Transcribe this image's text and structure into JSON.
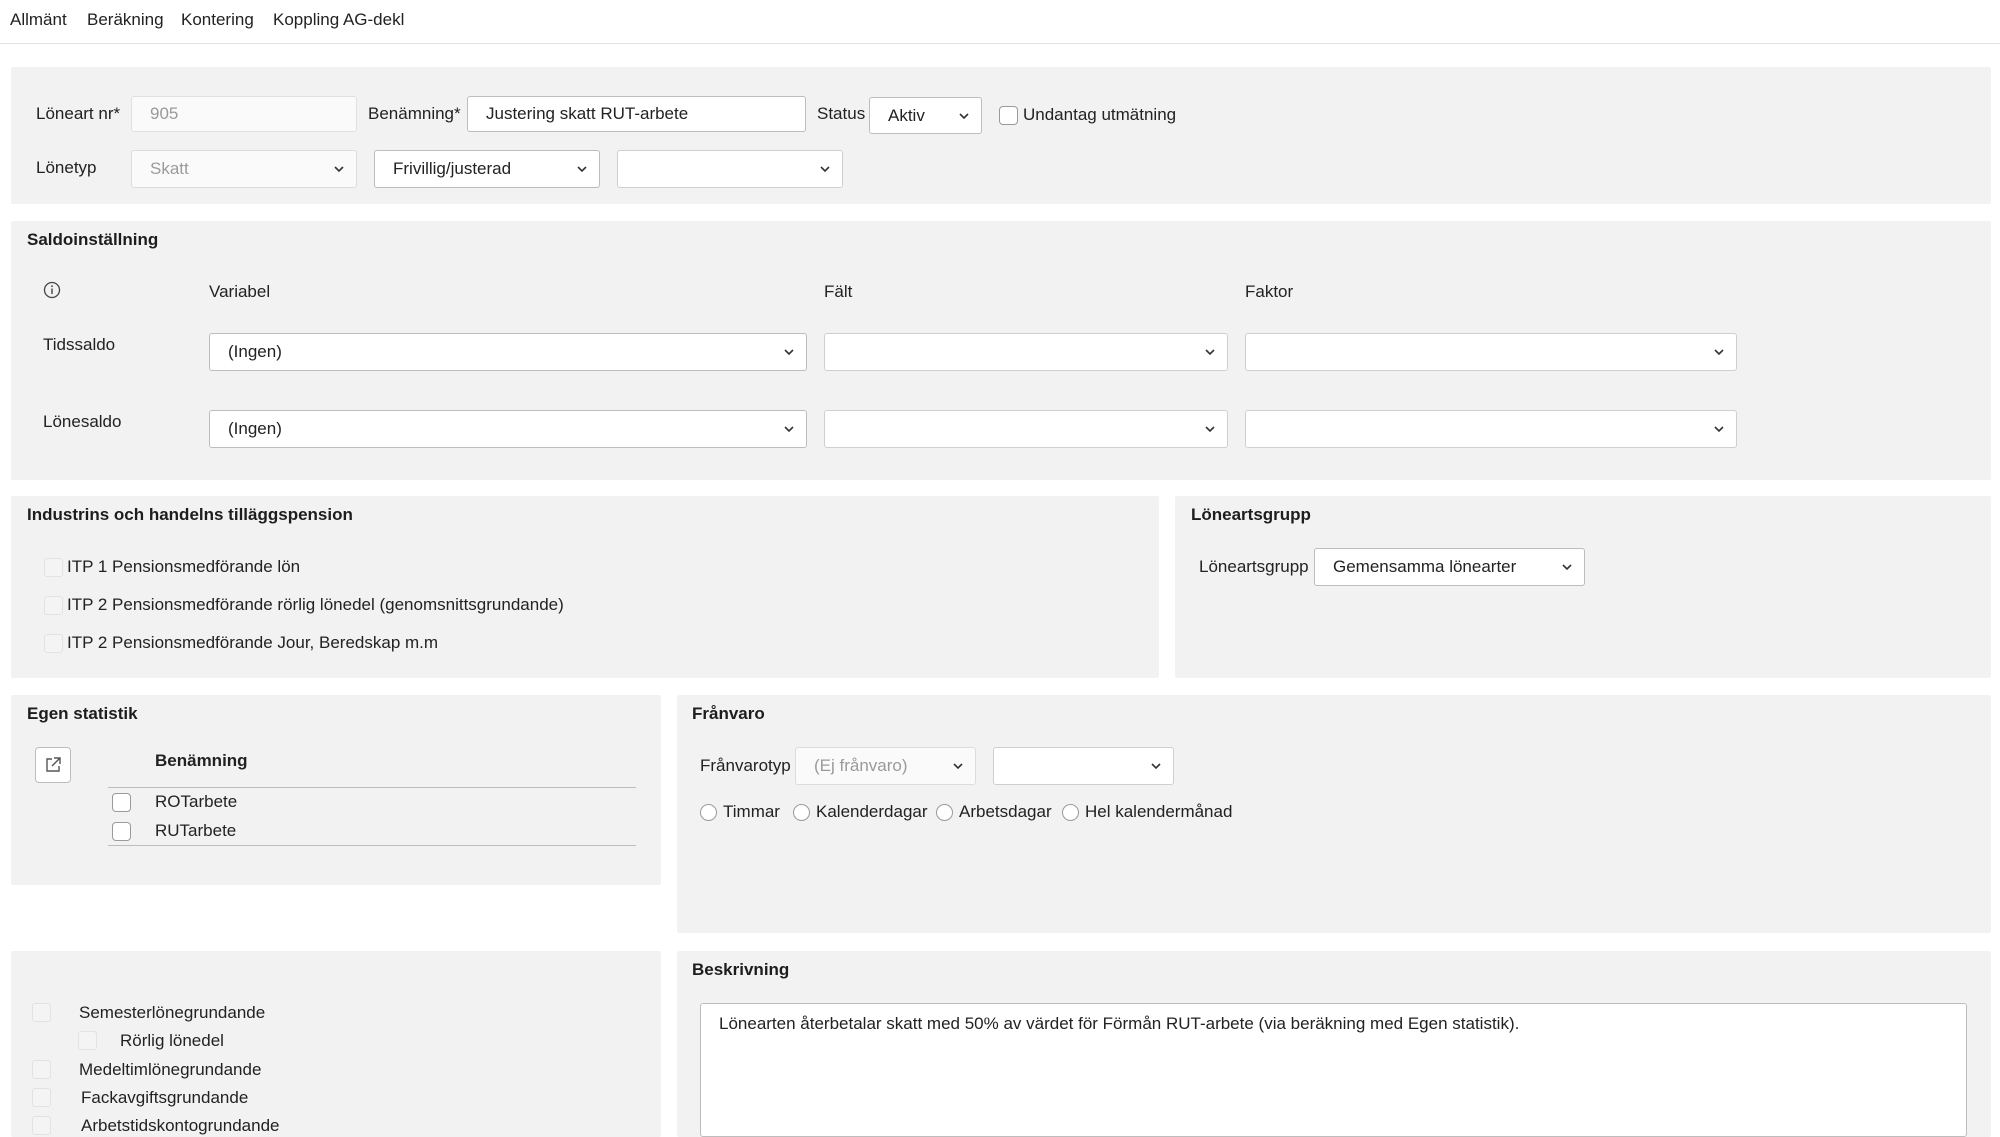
{
  "tabs": [
    "Allmänt",
    "Beräkning",
    "Kontering",
    "Koppling AG-dekl"
  ],
  "general": {
    "loneart_nr_label": "Löneart nr*",
    "loneart_nr_value": "905",
    "benamning_label": "Benämning*",
    "benamning_value": "Justering skatt RUT-arbete",
    "status_label": "Status",
    "status_value": "Aktiv",
    "undantag_label": "Undantag utmätning",
    "lonetyp_label": "Lönetyp",
    "lonetyp_value": "Skatt",
    "lonetyp_sub_value": "Frivillig/justerad",
    "lonetyp_third_value": ""
  },
  "saldo": {
    "title": "Saldoinställning",
    "col_variabel": "Variabel",
    "col_falt": "Fält",
    "col_faktor": "Faktor",
    "rows": [
      {
        "label": "Tidssaldo",
        "variabel": "(Ingen)",
        "falt": "",
        "faktor": ""
      },
      {
        "label": "Lönesaldo",
        "variabel": "(Ingen)",
        "falt": "",
        "faktor": ""
      }
    ]
  },
  "pension": {
    "title": "Industrins och handelns tilläggspension",
    "items": [
      "ITP 1 Pensionsmedförande lön",
      "ITP 2 Pensionsmedförande rörlig lönedel (genomsnittsgrundande)",
      "ITP 2 Pensionsmedförande Jour, Beredskap m.m"
    ]
  },
  "lonegrupp": {
    "title": "Löneartsgrupp",
    "label": "Löneartsgrupp",
    "value": "Gemensamma lönearter"
  },
  "statistik": {
    "title": "Egen statistik",
    "col_benamning": "Benämning",
    "rows": [
      "ROTarbete",
      "RUTarbete"
    ]
  },
  "franvaro": {
    "title": "Frånvaro",
    "typ_label": "Frånvarotyp",
    "typ_value": "(Ej frånvaro)",
    "typ_second": "",
    "radios": [
      "Timmar",
      "Kalenderdagar",
      "Arbetsdagar",
      "Hel kalendermånad"
    ]
  },
  "grundande": {
    "items": [
      "Semesterlönegrundande",
      "Rörlig lönedel",
      "Medeltimlönegrundande",
      "Fackavgiftsgrundande",
      "Arbetstidskontogrundande"
    ]
  },
  "beskrivning": {
    "title": "Beskrivning",
    "text": "Lönearten återbetalar skatt med 50% av värdet för Förmån RUT-arbete (via beräkning med Egen statistik)."
  },
  "icons": [
    "chevron-down-icon",
    "info-icon",
    "external-link-icon"
  ]
}
